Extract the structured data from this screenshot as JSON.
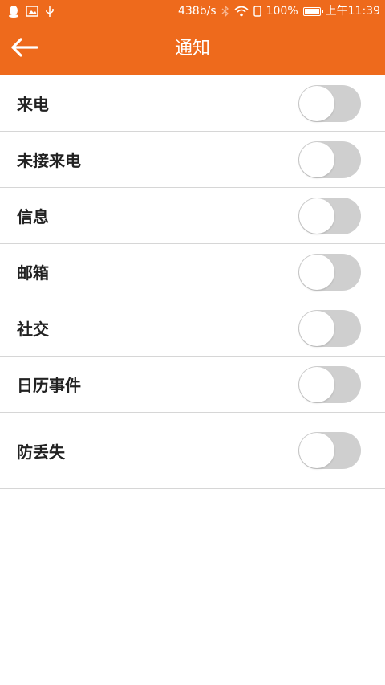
{
  "status_bar": {
    "net_speed": "438b/s",
    "battery": "100%",
    "battery_level": 1.0,
    "time": "上午11:39",
    "icons": [
      "qq-icon",
      "image-icon",
      "usb-icon",
      "bluetooth-icon",
      "wifi-icon",
      "vibrate-icon",
      "battery-icon"
    ]
  },
  "header": {
    "title": "通知",
    "back_icon": "back-arrow-icon",
    "background_color": "#ee6a1c"
  },
  "settings": {
    "items": [
      {
        "label": "来电",
        "enabled": false
      },
      {
        "label": "未接来电",
        "enabled": false
      },
      {
        "label": "信息",
        "enabled": false
      },
      {
        "label": "邮箱",
        "enabled": false
      },
      {
        "label": "社交",
        "enabled": false
      },
      {
        "label": "日历事件",
        "enabled": false
      },
      {
        "label": "防丢失",
        "enabled": false
      }
    ]
  },
  "colors": {
    "accent": "#ee6a1c",
    "toggle_off": "#cfcfcf",
    "divider": "#d6d6d6"
  }
}
